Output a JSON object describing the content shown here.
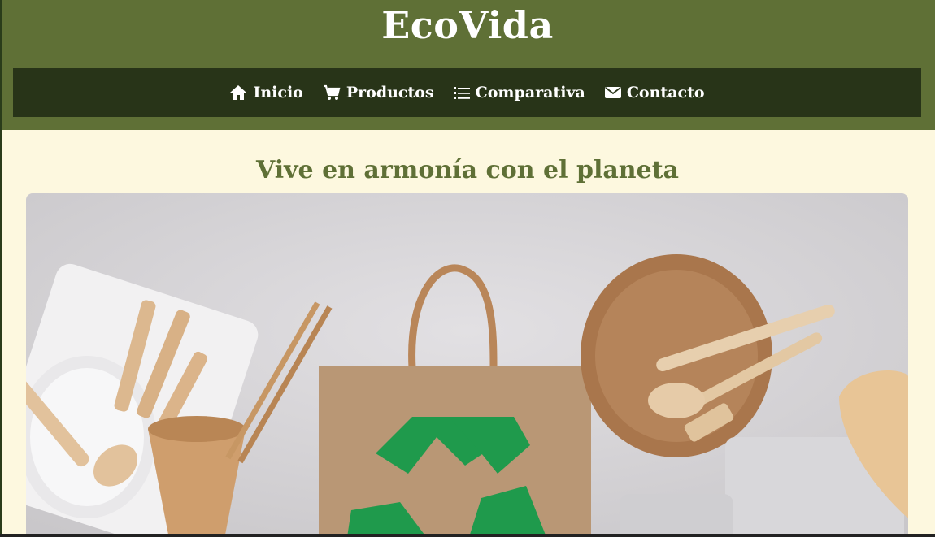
{
  "brand": {
    "name": "EcoVida"
  },
  "nav": {
    "items": [
      {
        "label": "Inicio",
        "icon": "home-icon"
      },
      {
        "label": "Productos",
        "icon": "cart-icon"
      },
      {
        "label": "Comparativa",
        "icon": "list-icon"
      },
      {
        "label": "Contacto",
        "icon": "envelope-icon"
      }
    ]
  },
  "hero": {
    "title": "Vive en armonía con el planeta",
    "image": "eco-products-photo"
  },
  "colors": {
    "header_bg": "#5f7036",
    "nav_bg": "#283418",
    "page_bg": "#fdf8df",
    "title": "#5f7036"
  }
}
